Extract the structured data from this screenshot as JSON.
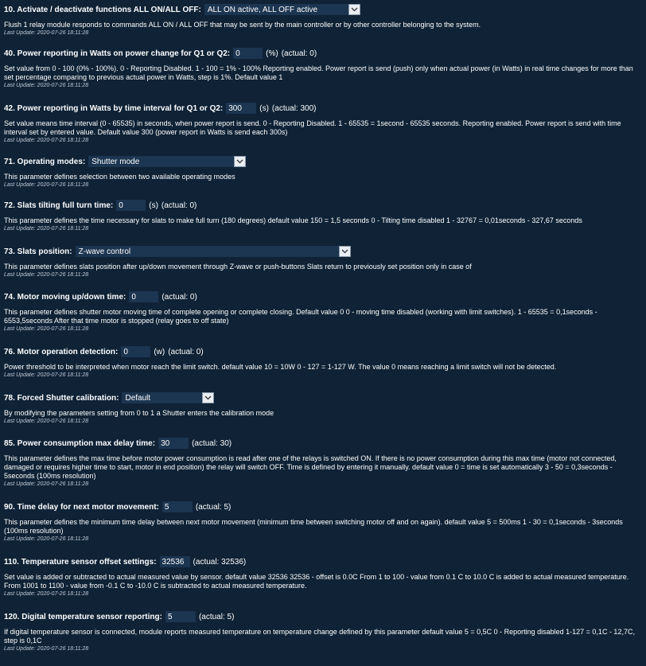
{
  "update_label": "Last Update:",
  "params": [
    {
      "id": "p10",
      "kind": "select",
      "label": "10. Activate / deactivate functions ALL ON/ALL OFF:",
      "value": "ALL ON active, ALL OFF active",
      "desc": "Flush 1 relay module responds to commands ALL ON / ALL OFF that may be sent by the main controller or by other controller belonging to the system.",
      "update": "2020-07-26 18:11:28"
    },
    {
      "id": "p40",
      "kind": "input",
      "label": "40. Power reporting in Watts on power change for Q1 or Q2:",
      "value": "0",
      "unit": "(%)",
      "actual": "(actual: 0)",
      "desc": "Set value from 0 - 100 (0% - 100%). 0 - Reporting Disabled. 1 - 100 = 1% - 100% Reporting enabled. Power report is send (push) only when actual power (in Watts) in real time changes for more than set percentage comparing to previous actual power in Watts, step is 1%. Default value 1",
      "update": "2020-07-26 18:11:28"
    },
    {
      "id": "p42",
      "kind": "input",
      "label": "42. Power reporting in Watts by time interval for Q1 or Q2:",
      "value": "300",
      "unit": "(s)",
      "actual": "(actual: 300)",
      "desc": "Set value means time interval (0 - 65535) in seconds, when power report is send. 0 - Reporting Disabled. 1 - 65535 = 1second - 65535 seconds. Reporting enabled. Power report is send with time interval set by entered value. Default value 300 (power report in Watts is send each 300s)",
      "update": "2020-07-26 18:11:28"
    },
    {
      "id": "p71",
      "kind": "select",
      "label": "71. Operating modes:",
      "value": "Shutter mode",
      "desc": "This parameter defines selection between two available operating modes",
      "update": "2020-07-26 18:11:28"
    },
    {
      "id": "p72",
      "kind": "input",
      "label": "72. Slats tilting full turn time:",
      "value": "0",
      "unit": "(s)",
      "actual": "(actual: 0)",
      "desc": "This parameter defines the time necessary for slats to make full turn (180 degrees) default value 150 = 1,5 seconds 0 - Tilting time disabled 1 - 32767 = 0,01seconds - 327,67 seconds",
      "update": "2020-07-26 18:11:28"
    },
    {
      "id": "p73",
      "kind": "select",
      "label": "73. Slats position:",
      "value": "Z-wave control",
      "desc": "This parameter defines slats position after up/down movement through Z-wave or push-buttons Slats return to previously set position only in case of",
      "update": "2020-07-26 18:11:28"
    },
    {
      "id": "p74",
      "kind": "input",
      "label": "74. Motor moving up/down time:",
      "value": "0",
      "unit": "",
      "actual": "(actual: 0)",
      "desc": "This parameter defines shutter motor moving time of complete opening or complete closing. Default value 0 0 - moving time disabled (working with limit switches). 1 - 65535 = 0,1seconds - 6553,5seconds After that time motor is stopped (relay goes to off state)",
      "update": "2020-07-26 18:11:28"
    },
    {
      "id": "p76",
      "kind": "input",
      "label": "76. Motor operation detection:",
      "value": "0",
      "unit": "(w)",
      "actual": "(actual: 0)",
      "desc": "Power threshold to be interpreted when motor reach the limit switch. default value 10 = 10W 0 - 127 = 1-127 W. The value 0 means reaching a limit switch will not be detected.",
      "update": "2020-07-26 18:11:28"
    },
    {
      "id": "p78",
      "kind": "select",
      "label": "78. Forced Shutter calibration:",
      "value": "Default",
      "desc": "By modifying the parameters setting from 0 to 1 a Shutter enters the calibration mode",
      "update": "2020-07-26 18:11:28"
    },
    {
      "id": "p85",
      "kind": "input",
      "label": "85. Power consumption max delay time:",
      "value": "30",
      "unit": "",
      "actual": "(actual: 30)",
      "desc": "This parameter defines the max time before motor power consumption is read after one of the relays is switched ON. If there is no power consumption during this max time (motor not connected, damaged or requires higher time to start, motor in end position) the relay will switch OFF. Time is defined by entering it manually. default value 0 = time is set automatically 3 - 50 = 0,3seconds - 5seconds (100ms resolution)",
      "update": "2020-07-26 18:11:28"
    },
    {
      "id": "p90",
      "kind": "input",
      "label": "90. Time delay for next motor movement:",
      "value": "5",
      "unit": "",
      "actual": "(actual: 5)",
      "desc": "This parameter defines the minimum time delay between next motor movement (minimum time between switching motor off and on again). default value 5 = 500ms 1 - 30 = 0,1seconds - 3seconds (100ms resolution)",
      "update": "2020-07-26 18:11:28"
    },
    {
      "id": "p110",
      "kind": "input",
      "label": "110. Temperature sensor offset settings:",
      "value": "32536",
      "unit": "",
      "actual": "(actual: 32536)",
      "desc": "Set value is added or subtracted to actual measured value by sensor. default value 32536 32536 - offset is 0.0C From 1 to 100 - value from 0.1 C to 10.0 C is added to actual measured temperature. From 1001 to 1100 - value from -0.1 C to -10.0 C is subtracted to actual measured temperature.",
      "update": "2020-07-26 18:11:28"
    },
    {
      "id": "p120",
      "kind": "input",
      "label": "120. Digital temperature sensor reporting:",
      "value": "5",
      "unit": "",
      "actual": "(actual: 5)",
      "desc": "If digital temperature sensor is connected, module reports measured temperature on temperature change defined by this parameter default value 5 = 0,5C 0 - Reporting disabled 1-127 = 0,1C - 12,7C, step is 0,1C",
      "update": "2020-07-26 18:11:28"
    }
  ]
}
